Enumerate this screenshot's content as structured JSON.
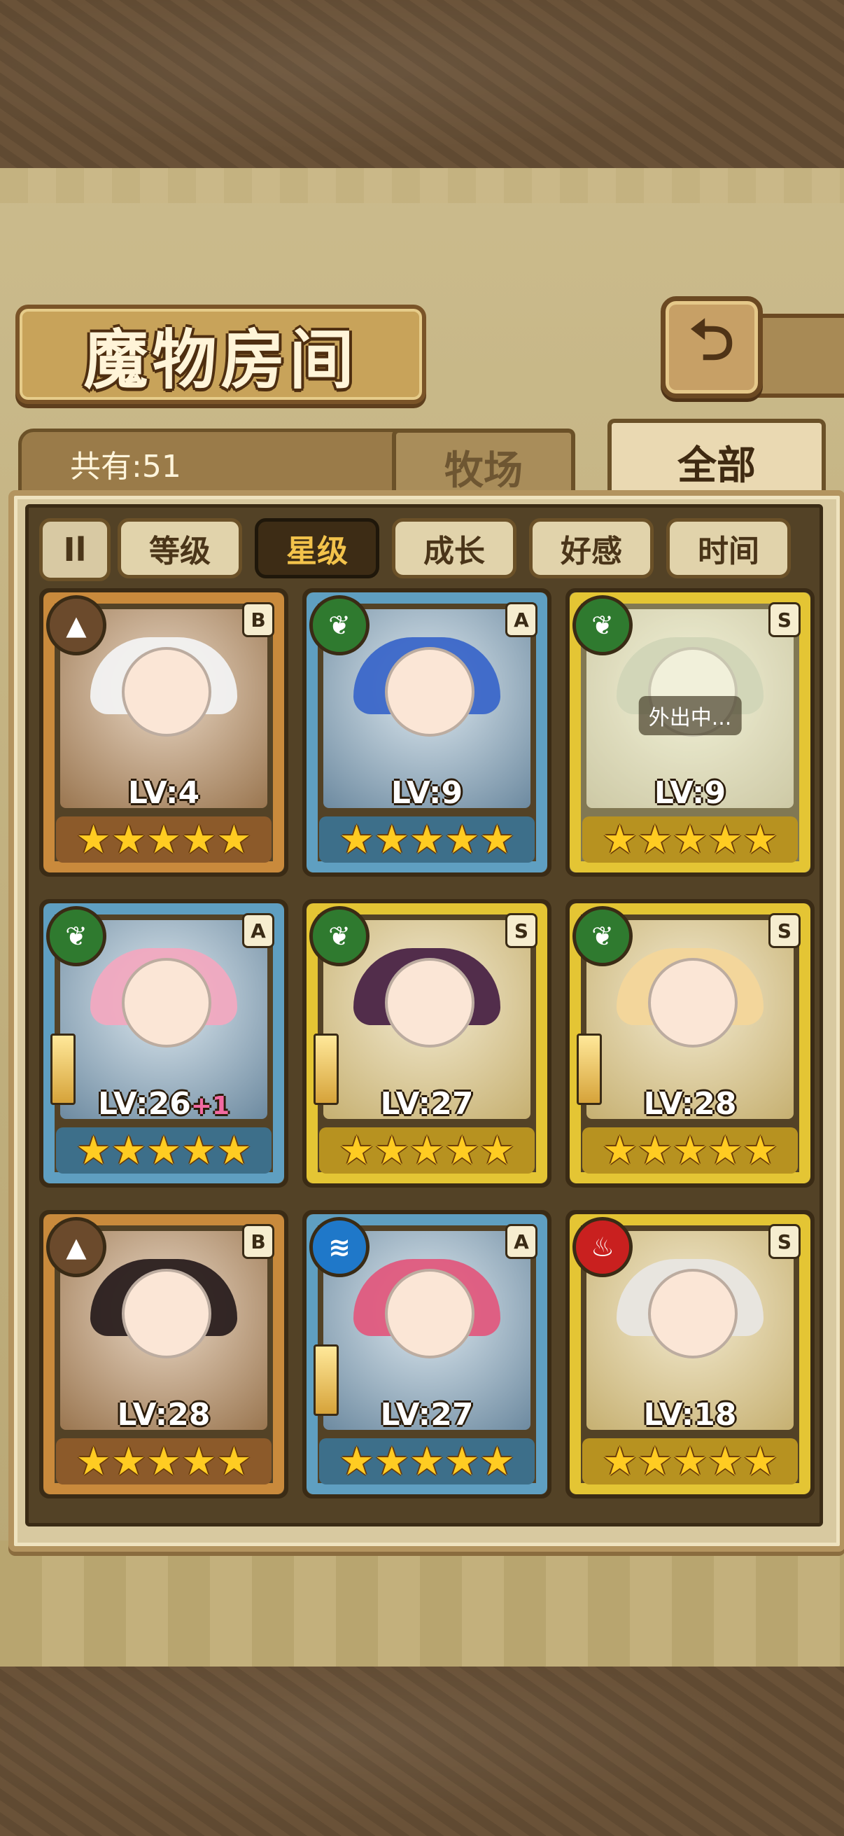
{
  "header": {
    "title": "魔物房间",
    "back_icon": "back-arrow-icon"
  },
  "roster": {
    "count_label": "共有:51"
  },
  "tabs": [
    {
      "label": "牧场",
      "active": false
    },
    {
      "label": "全部",
      "active": true
    }
  ],
  "sort": {
    "toggle_label": "Il",
    "options": [
      {
        "label": "等级",
        "active": false
      },
      {
        "label": "星级",
        "active": true
      },
      {
        "label": "成长",
        "active": false
      },
      {
        "label": "好感",
        "active": false
      },
      {
        "label": "时间",
        "active": false
      }
    ]
  },
  "monsters": [
    {
      "element": "earth",
      "element_icon": "mountain-icon",
      "rank": "B",
      "level": "LV:4",
      "bonus": "",
      "stars": "★★★★★",
      "status": "",
      "frame": "bronze",
      "has_weapon": false
    },
    {
      "element": "nature",
      "element_icon": "leaf-icon",
      "rank": "A",
      "level": "LV:9",
      "bonus": "",
      "stars": "★★★★★",
      "status": "",
      "frame": "blue",
      "has_weapon": false
    },
    {
      "element": "nature",
      "element_icon": "leaf-icon",
      "rank": "S",
      "level": "LV:9",
      "bonus": "",
      "stars": "★★★★★",
      "status": "外出中...",
      "frame": "gold",
      "has_weapon": false
    },
    {
      "element": "nature",
      "element_icon": "leaf-icon",
      "rank": "A",
      "level": "LV:26",
      "bonus": "+1",
      "stars": "★★★★★",
      "status": "",
      "frame": "blue",
      "has_weapon": true
    },
    {
      "element": "nature",
      "element_icon": "leaf-icon",
      "rank": "S",
      "level": "LV:27",
      "bonus": "",
      "stars": "★★★★★",
      "status": "",
      "frame": "gold",
      "has_weapon": true
    },
    {
      "element": "nature",
      "element_icon": "leaf-icon",
      "rank": "S",
      "level": "LV:28",
      "bonus": "",
      "stars": "★★★★★",
      "status": "",
      "frame": "gold",
      "has_weapon": true
    },
    {
      "element": "earth",
      "element_icon": "mountain-icon",
      "rank": "B",
      "level": "LV:28",
      "bonus": "",
      "stars": "★★★★★",
      "status": "",
      "frame": "bronze",
      "has_weapon": false
    },
    {
      "element": "water",
      "element_icon": "water-wave-icon",
      "rank": "A",
      "level": "LV:27",
      "bonus": "",
      "stars": "★★★★★",
      "status": "",
      "frame": "blue",
      "has_weapon": true
    },
    {
      "element": "fire",
      "element_icon": "flame-icon",
      "rank": "S",
      "level": "LV:18",
      "bonus": "",
      "stars": "★★★★★",
      "status": "",
      "frame": "gold",
      "has_weapon": false
    }
  ],
  "colors": {
    "earth": "#6b4a2c",
    "nature": "#2f7a2f",
    "water": "#1f78c9",
    "fire": "#c9201f",
    "active_sort_text": "#f3c34b"
  }
}
